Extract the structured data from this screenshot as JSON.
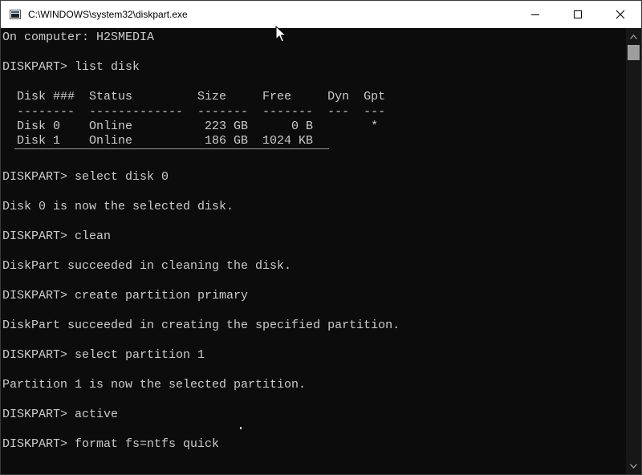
{
  "window": {
    "title": "C:\\WINDOWS\\system32\\diskpart.exe",
    "controls": {
      "minimize_icon": "minimize-icon",
      "maximize_icon": "maximize-icon",
      "close_icon": "close-icon"
    }
  },
  "console": {
    "lines": [
      "On computer: H2SMEDIA",
      "",
      "DISKPART> list disk",
      "",
      "  Disk ###  Status         Size     Free     Dyn  Gpt",
      "  --------  -------------  -------  -------  ---  ---",
      "  Disk 0    Online          223 GB      0 B        *",
      "  Disk 1    Online          186 GB  1024 KB",
      "",
      "DISKPART> select disk 0",
      "",
      "Disk 0 is now the selected disk.",
      "",
      "DISKPART> clean",
      "",
      "DiskPart succeeded in cleaning the disk.",
      "",
      "DISKPART> create partition primary",
      "",
      "DiskPart succeeded in creating the specified partition.",
      "",
      "DISKPART> select partition 1",
      "",
      "Partition 1 is now the selected partition.",
      "",
      "DISKPART> active",
      "",
      "DISKPART> format fs=ntfs quick"
    ]
  },
  "colors": {
    "console_bg": "#0c0c0c",
    "console_text": "#cccccc",
    "titlebar_bg": "#ffffff"
  }
}
